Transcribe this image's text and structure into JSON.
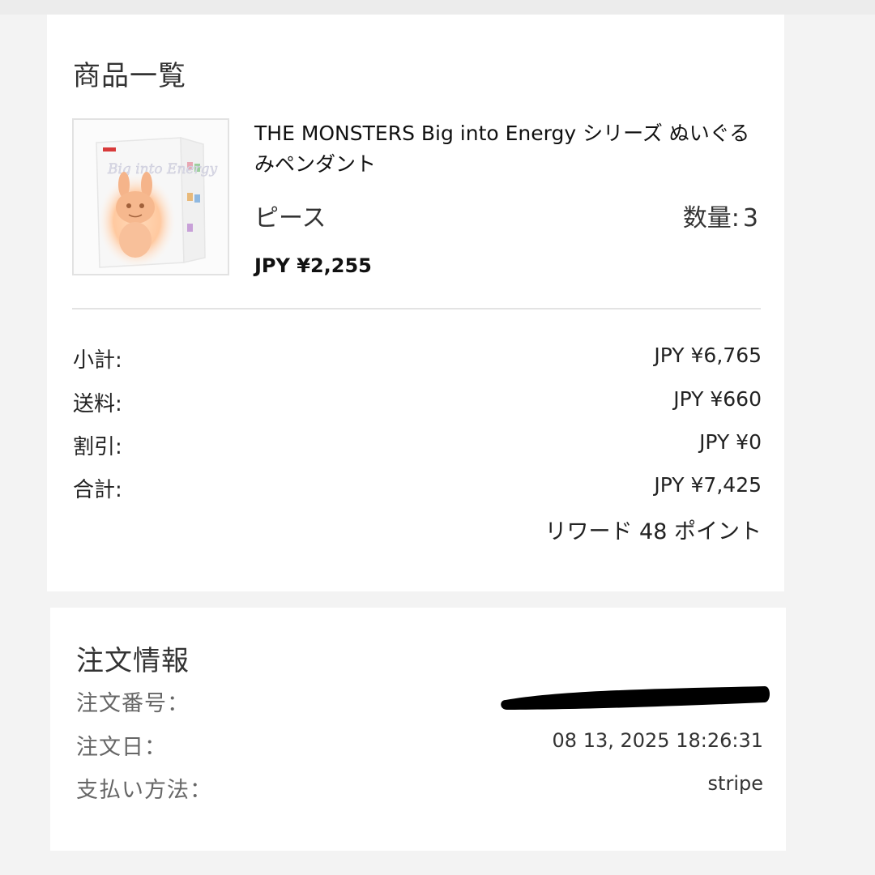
{
  "products_section": {
    "title": "商品一覧",
    "item": {
      "name": "THE MONSTERS Big into Energy シリーズ ぬいぐるみペンダント",
      "variant": "ピース",
      "quantity_label": "数量:",
      "quantity": "3",
      "price": "JPY ¥2,255",
      "box_text": "Big into Energy"
    }
  },
  "summary": {
    "subtotal_label": "小計:",
    "subtotal_value": "JPY ¥6,765",
    "shipping_label": "送料:",
    "shipping_value": "JPY ¥660",
    "discount_label": "割引:",
    "discount_value": "JPY ¥0",
    "total_label": "合計:",
    "total_value": "JPY ¥7,425",
    "reward": "リワード 48 ポイント"
  },
  "order_info": {
    "title": "注文情報",
    "number_label": "注文番号：",
    "date_label": "注文日：",
    "date_value": "08 13, 2025 18:26:31",
    "payment_label": "支払い方法：",
    "payment_value": "stripe"
  }
}
